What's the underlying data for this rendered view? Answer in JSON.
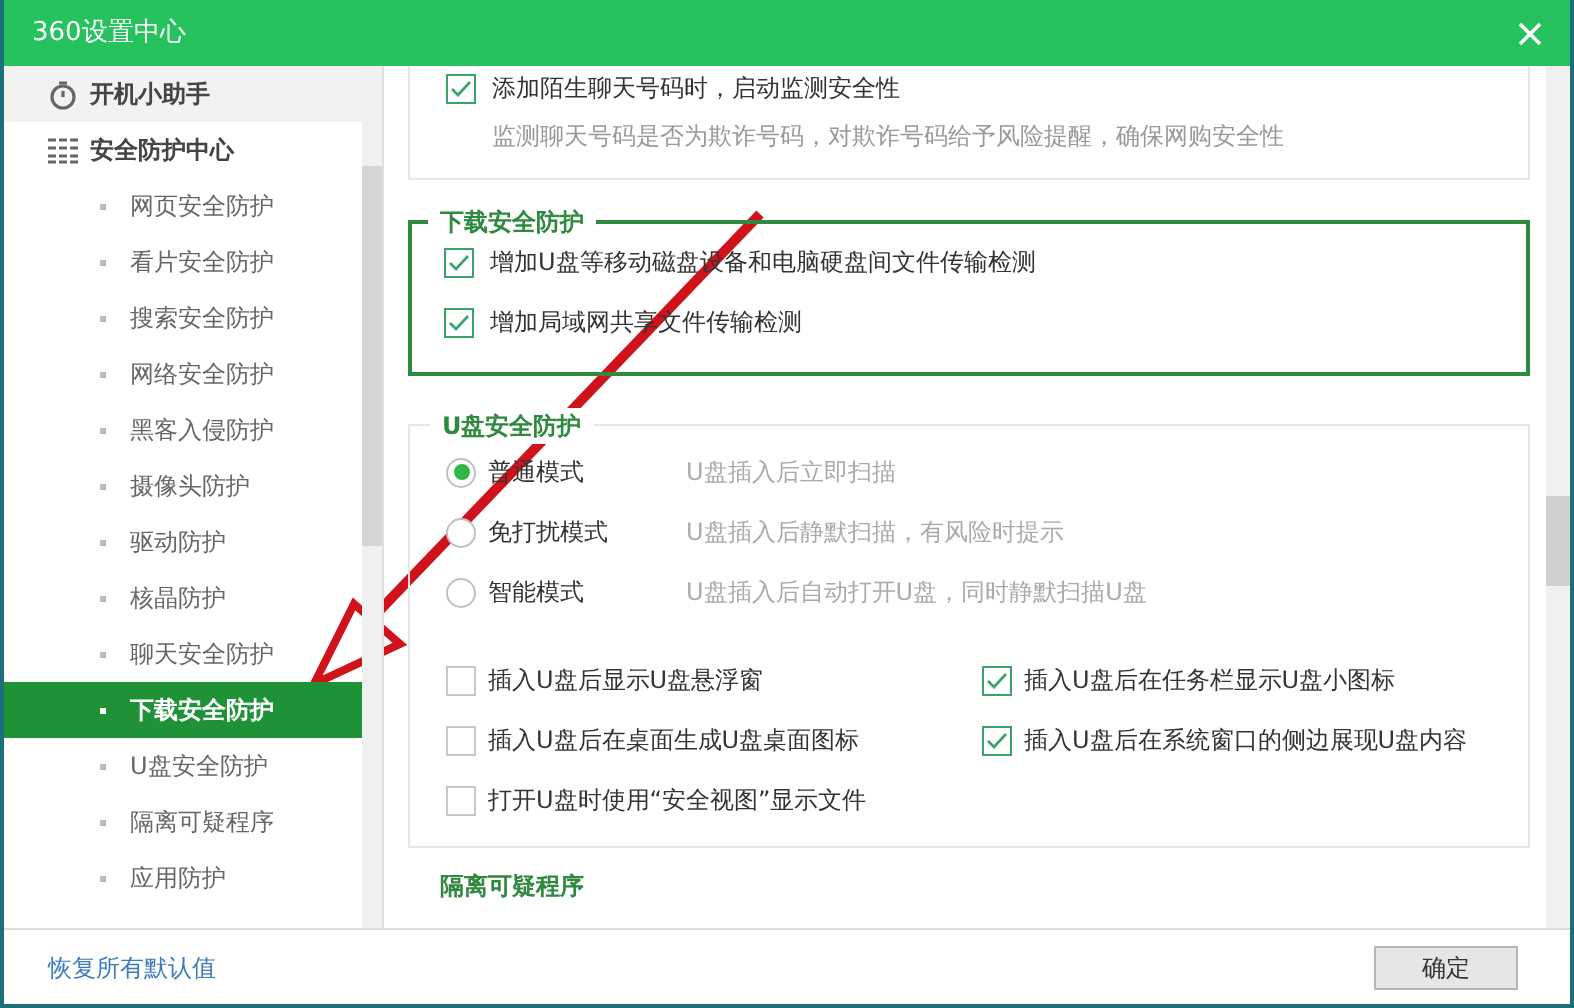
{
  "window": {
    "title": "360设置中心"
  },
  "sidebar": {
    "items": [
      {
        "label": "开机小助手"
      },
      {
        "label": "安全防护中心",
        "children": [
          {
            "label": "网页安全防护",
            "selected": false
          },
          {
            "label": "看片安全防护",
            "selected": false
          },
          {
            "label": "搜索安全防护",
            "selected": false
          },
          {
            "label": "网络安全防护",
            "selected": false
          },
          {
            "label": "黑客入侵防护",
            "selected": false
          },
          {
            "label": "摄像头防护",
            "selected": false
          },
          {
            "label": "驱动防护",
            "selected": false
          },
          {
            "label": "核晶防护",
            "selected": false
          },
          {
            "label": "聊天安全防护",
            "selected": false
          },
          {
            "label": "下载安全防护",
            "selected": true
          },
          {
            "label": "U盘安全防护",
            "selected": false
          },
          {
            "label": "隔离可疑程序",
            "selected": false
          },
          {
            "label": "应用防护",
            "selected": false
          }
        ]
      }
    ]
  },
  "chat_section": {
    "option": {
      "label": "添加陌生聊天号码时，启动监测安全性",
      "checked": true
    },
    "description": "监测聊天号码是否为欺诈号码，对欺诈号码给予风险提醒，确保网购安全性"
  },
  "download_section": {
    "title": "下载安全防护",
    "options": [
      {
        "label": "增加U盘等移动磁盘设备和电脑硬盘间文件传输检测",
        "checked": true
      },
      {
        "label": "增加局域网共享文件传输检测",
        "checked": true
      }
    ]
  },
  "usb_section": {
    "title": "U盘安全防护",
    "modes": [
      {
        "label": "普通模式",
        "description": "U盘插入后立即扫描",
        "selected": true
      },
      {
        "label": "免打扰模式",
        "description": "U盘插入后静默扫描，有风险时提示",
        "selected": false
      },
      {
        "label": "智能模式",
        "description": "U盘插入后自动打开U盘，同时静默扫描U盘",
        "selected": false
      }
    ],
    "options": [
      {
        "label": "插入U盘后显示U盘悬浮窗",
        "checked": false
      },
      {
        "label": "插入U盘后在任务栏显示U盘小图标",
        "checked": true
      },
      {
        "label": "插入U盘后在桌面生成U盘桌面图标",
        "checked": false
      },
      {
        "label": "插入U盘后在系统窗口的侧边展现U盘内容",
        "checked": true
      },
      {
        "label": "打开U盘时使用“安全视图”显示文件",
        "checked": false
      }
    ]
  },
  "next_section": {
    "title": "隔离可疑程序"
  },
  "footer": {
    "restore_link": "恢复所有默认值",
    "ok_button": "确定"
  }
}
